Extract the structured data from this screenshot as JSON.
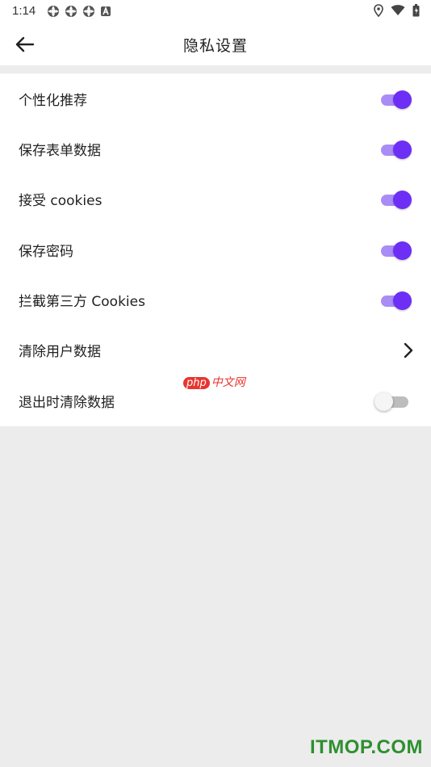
{
  "status_bar": {
    "time": "1:14",
    "left_icons": [
      "sync-icon",
      "sync-icon",
      "sync-icon",
      "a-badge-icon"
    ],
    "right_icons": [
      "location-icon",
      "wifi-icon",
      "battery-icon"
    ]
  },
  "header": {
    "title": "隐私设置",
    "back_icon": "arrow-left-icon"
  },
  "settings": [
    {
      "label": "个性化推荐",
      "control": "toggle",
      "on": true
    },
    {
      "label": "保存表单数据",
      "control": "toggle",
      "on": true
    },
    {
      "label": "接受 cookies",
      "control": "toggle",
      "on": true
    },
    {
      "label": "保存密码",
      "control": "toggle",
      "on": true
    },
    {
      "label": "拦截第三方 Cookies",
      "control": "toggle",
      "on": true
    },
    {
      "label": "清除用户数据",
      "control": "chevron"
    },
    {
      "label": "退出时清除数据",
      "control": "toggle",
      "on": false
    }
  ],
  "colors": {
    "accent": "#6d2ef5",
    "accent_track": "#a98cf5",
    "background": "#ececec"
  },
  "watermarks": {
    "php_logo": "php",
    "php_text": "中文网",
    "itmop": "ITMOP.COM"
  }
}
